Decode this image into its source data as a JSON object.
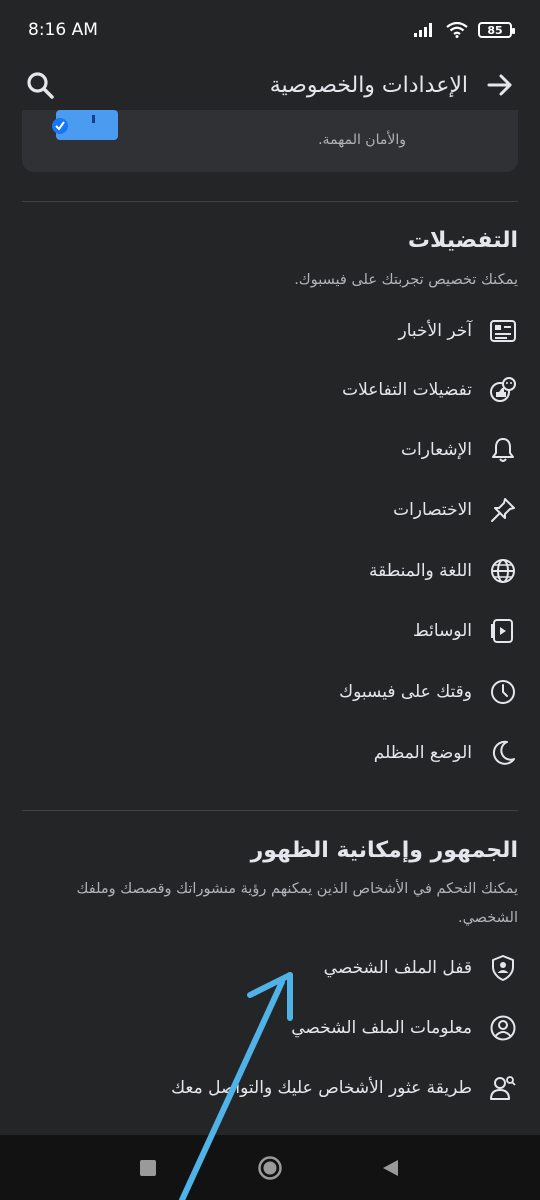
{
  "status": {
    "time": "8:16 AM",
    "battery": "85"
  },
  "header": {
    "title": "الإعدادات والخصوصية"
  },
  "card": {
    "text": "والأمان المهمة."
  },
  "preferences": {
    "title": "التفضيلات",
    "subtitle": "يمكنك تخصيص تجربتك على فيسبوك.",
    "items": [
      {
        "label": "آخر الأخبار",
        "icon": "news-feed-icon"
      },
      {
        "label": "تفضيلات التفاعلات",
        "icon": "reactions-icon"
      },
      {
        "label": "الإشعارات",
        "icon": "bell-icon"
      },
      {
        "label": "الاختصارات",
        "icon": "pin-icon"
      },
      {
        "label": "اللغة والمنطقة",
        "icon": "globe-icon"
      },
      {
        "label": "الوسائط",
        "icon": "media-icon"
      },
      {
        "label": "وقتك على فيسبوك",
        "icon": "clock-icon"
      },
      {
        "label": "الوضع المظلم",
        "icon": "moon-icon"
      }
    ]
  },
  "audience": {
    "title": "الجمهور وإمكانية الظهور",
    "subtitle_line1": "يمكنك التحكم في الأشخاص الذين يمكنهم رؤية منشوراتك وقصصك وملفك",
    "subtitle_line2": "الشخصي.",
    "items": [
      {
        "label": "قفل الملف الشخصي",
        "icon": "shield-user-icon"
      },
      {
        "label": "معلومات الملف الشخصي",
        "icon": "profile-icon"
      },
      {
        "label": "طريقة عثور الأشخاص عليك والتواصل معك",
        "icon": "people-search-icon"
      }
    ]
  },
  "colors": {
    "background": "#242527",
    "arrow": "#4fb3e8",
    "accent": "#1877f2"
  }
}
